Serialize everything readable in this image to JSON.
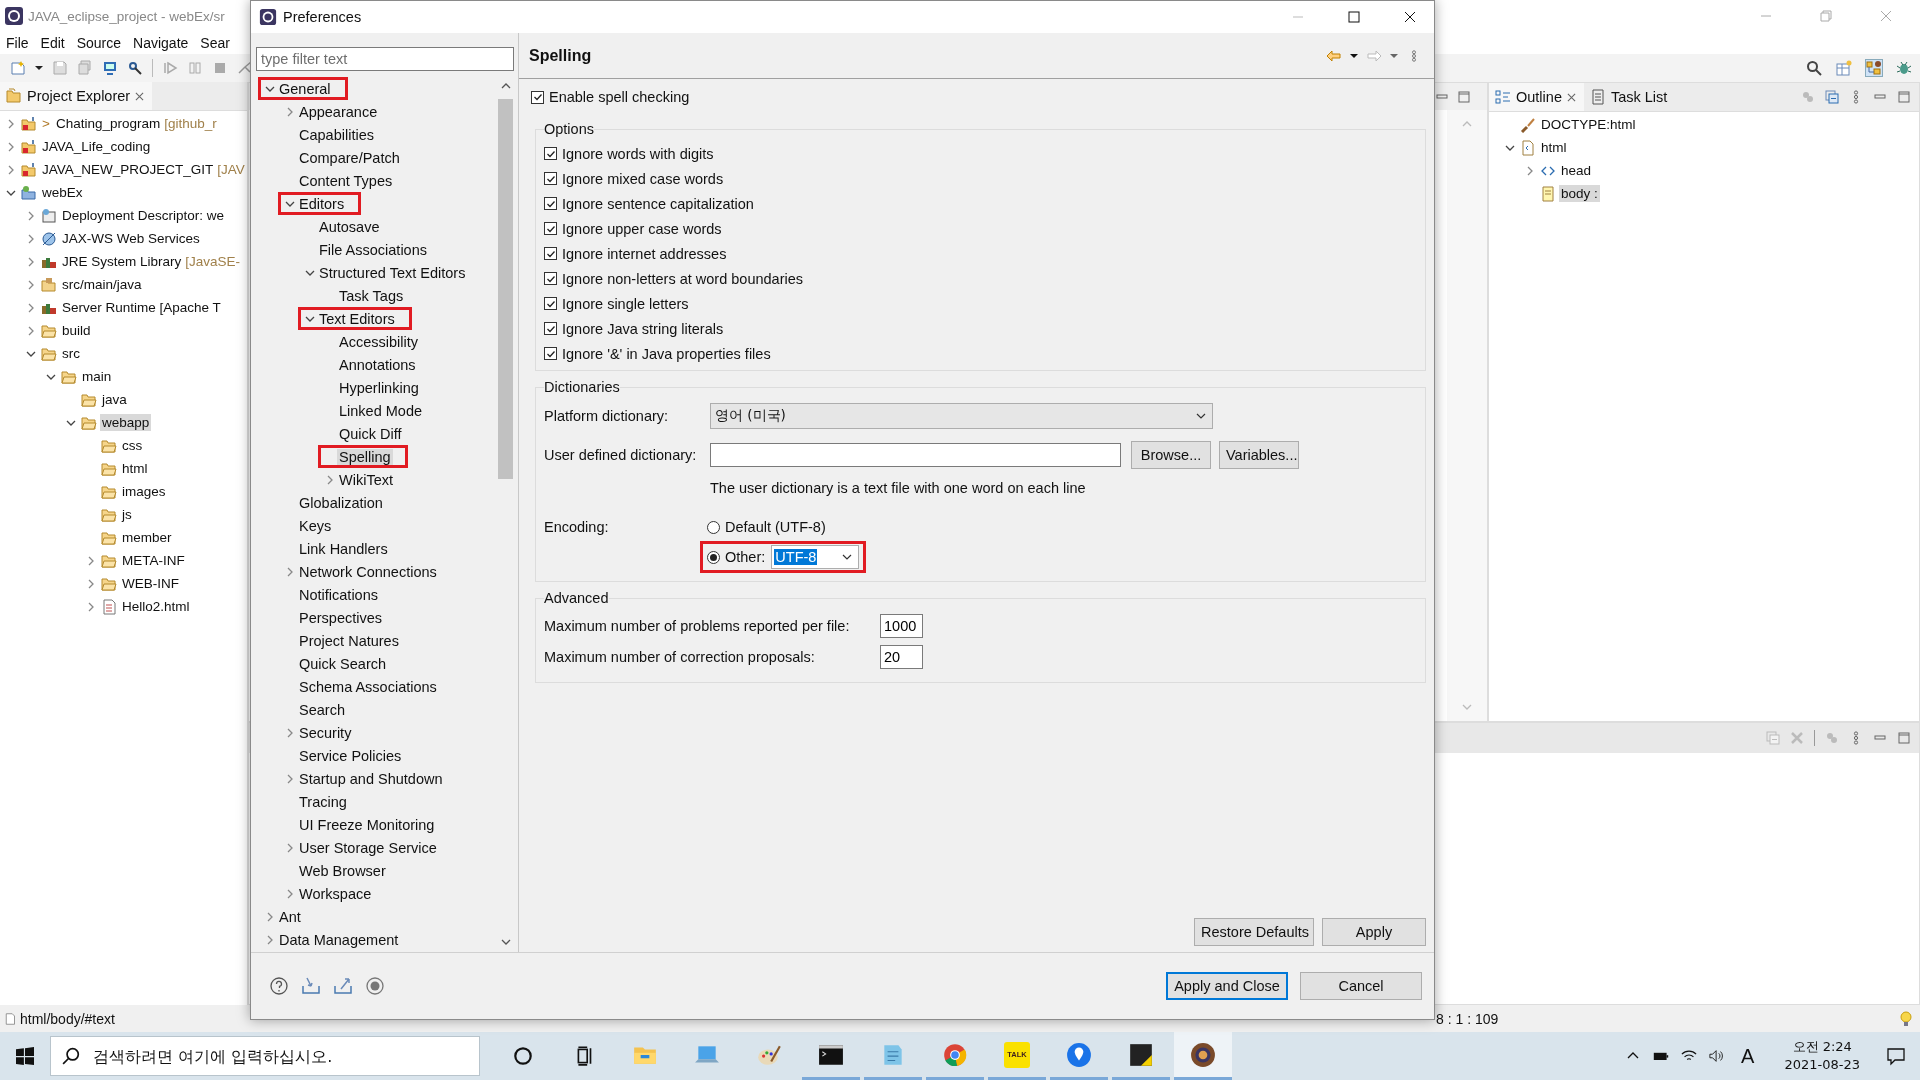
{
  "eclipse": {
    "title": "JAVA_eclipse_project - webEx/sr",
    "menu": [
      "File",
      "Edit",
      "Source",
      "Navigate",
      "Sear"
    ],
    "project_explorer": {
      "tab": "Project Explorer",
      "items": [
        {
          "name": "Chating_program",
          "marker": ">",
          "decoration": "[github_r",
          "kind": "git-project",
          "expanded": false,
          "selected": false
        },
        {
          "name": "JAVA_Life_coding",
          "kind": "git-project",
          "expanded": false,
          "selected": false
        },
        {
          "name": "JAVA_NEW_PROJECT_GIT",
          "decoration": "[JAV",
          "kind": "git-project",
          "expanded": false,
          "selected": false
        },
        {
          "name": "webEx",
          "kind": "web-project",
          "expanded": true,
          "selected": false,
          "children": [
            {
              "name": "Deployment Descriptor: we",
              "kind": "descriptor",
              "expanded": false,
              "selected": false
            },
            {
              "name": "JAX-WS Web Services",
              "kind": "webservice",
              "expanded": false,
              "selected": false
            },
            {
              "name": "JRE System Library",
              "decoration": "[JavaSE-",
              "kind": "library",
              "expanded": false,
              "selected": false
            },
            {
              "name": "src/main/java",
              "kind": "source",
              "expanded": false,
              "selected": false
            },
            {
              "name": "Server Runtime [Apache T",
              "kind": "library",
              "expanded": false,
              "selected": false
            },
            {
              "name": "build",
              "kind": "folder",
              "expanded": false,
              "selected": false
            },
            {
              "name": "src",
              "kind": "folder",
              "expanded": true,
              "selected": false,
              "children": [
                {
                  "name": "main",
                  "kind": "folder",
                  "expanded": true,
                  "selected": false,
                  "children": [
                    {
                      "name": "java",
                      "kind": "folder",
                      "selected": false
                    },
                    {
                      "name": "webapp",
                      "kind": "folder",
                      "expanded": true,
                      "selected": true,
                      "children": [
                        {
                          "name": "css",
                          "kind": "folder",
                          "selected": false
                        },
                        {
                          "name": "html",
                          "kind": "folder",
                          "selected": false
                        },
                        {
                          "name": "images",
                          "kind": "folder",
                          "selected": false
                        },
                        {
                          "name": "js",
                          "kind": "folder",
                          "selected": false
                        },
                        {
                          "name": "member",
                          "kind": "folder",
                          "selected": false
                        },
                        {
                          "name": "META-INF",
                          "kind": "folder",
                          "expanded": false,
                          "selected": false
                        },
                        {
                          "name": "WEB-INF",
                          "kind": "folder",
                          "expanded": false,
                          "selected": false
                        },
                        {
                          "name": "Hello2.html",
                          "kind": "file",
                          "expanded": false,
                          "selected": false
                        }
                      ]
                    }
                  ]
                }
              ]
            }
          ]
        }
      ]
    },
    "outline": {
      "tabs": [
        {
          "label": "Outline",
          "selected": true
        },
        {
          "label": "Task List",
          "selected": false
        }
      ],
      "items": [
        {
          "name": "DOCTYPE:html",
          "kind": "doctype",
          "selected": false
        },
        {
          "name": "html",
          "kind": "element",
          "expanded": true,
          "selected": false,
          "children": [
            {
              "name": "head",
              "kind": "tag",
              "expanded": false,
              "selected": false
            },
            {
              "name": "body :",
              "kind": "text-node",
              "selected": true
            }
          ]
        }
      ]
    },
    "status_bar": {
      "path": "html/body/#text",
      "position": "8 : 1 : 109"
    }
  },
  "preferences": {
    "title": "Preferences",
    "filter_placeholder": "type filter text",
    "tree": [
      {
        "label": "General",
        "expanded": true,
        "selected": false,
        "annotated": true,
        "children": [
          {
            "label": "Appearance",
            "expanded": false,
            "selected": false,
            "annotated": false
          },
          {
            "label": "Capabilities",
            "selected": false,
            "annotated": false
          },
          {
            "label": "Compare/Patch",
            "selected": false,
            "annotated": false
          },
          {
            "label": "Content Types",
            "selected": false,
            "annotated": false
          },
          {
            "label": "Editors",
            "expanded": true,
            "selected": false,
            "annotated": true,
            "children": [
              {
                "label": "Autosave",
                "selected": false,
                "annotated": false
              },
              {
                "label": "File Associations",
                "selected": false,
                "annotated": false
              },
              {
                "label": "Structured Text Editors",
                "expanded": true,
                "selected": false,
                "annotated": false,
                "children": [
                  {
                    "label": "Task Tags",
                    "selected": false,
                    "annotated": false
                  }
                ]
              },
              {
                "label": "Text Editors",
                "expanded": true,
                "selected": false,
                "annotated": true,
                "children": [
                  {
                    "label": "Accessibility",
                    "selected": false,
                    "annotated": false
                  },
                  {
                    "label": "Annotations",
                    "selected": false,
                    "annotated": false
                  },
                  {
                    "label": "Hyperlinking",
                    "selected": false,
                    "annotated": false
                  },
                  {
                    "label": "Linked Mode",
                    "selected": false,
                    "annotated": false
                  },
                  {
                    "label": "Quick Diff",
                    "selected": false,
                    "annotated": false
                  },
                  {
                    "label": "Spelling",
                    "selected": true,
                    "annotated": true
                  },
                  {
                    "label": "WikiText",
                    "expanded": false,
                    "selected": false,
                    "annotated": false
                  }
                ]
              }
            ]
          },
          {
            "label": "Globalization",
            "selected": false,
            "annotated": false
          },
          {
            "label": "Keys",
            "selected": false,
            "annotated": false
          },
          {
            "label": "Link Handlers",
            "selected": false,
            "annotated": false
          },
          {
            "label": "Network Connections",
            "expanded": false,
            "selected": false,
            "annotated": false
          },
          {
            "label": "Notifications",
            "selected": false,
            "annotated": false
          },
          {
            "label": "Perspectives",
            "selected": false,
            "annotated": false
          },
          {
            "label": "Project Natures",
            "selected": false,
            "annotated": false
          },
          {
            "label": "Quick Search",
            "selected": false,
            "annotated": false
          },
          {
            "label": "Schema Associations",
            "selected": false,
            "annotated": false
          },
          {
            "label": "Search",
            "selected": false,
            "annotated": false
          },
          {
            "label": "Security",
            "expanded": false,
            "selected": false,
            "annotated": false
          },
          {
            "label": "Service Policies",
            "selected": false,
            "annotated": false
          },
          {
            "label": "Startup and Shutdown",
            "expanded": false,
            "selected": false,
            "annotated": false
          },
          {
            "label": "Tracing",
            "selected": false,
            "annotated": false
          },
          {
            "label": "UI Freeze Monitoring",
            "selected": false,
            "annotated": false
          },
          {
            "label": "User Storage Service",
            "expanded": false,
            "selected": false,
            "annotated": false
          },
          {
            "label": "Web Browser",
            "selected": false,
            "annotated": false
          },
          {
            "label": "Workspace",
            "expanded": false,
            "selected": false,
            "annotated": false
          }
        ]
      },
      {
        "label": "Ant",
        "expanded": false,
        "selected": false,
        "annotated": false
      },
      {
        "label": "Data Management",
        "expanded": false,
        "selected": false,
        "annotated": false
      }
    ],
    "page": {
      "title": "Spelling",
      "enable": {
        "label": "Enable spell checking",
        "checked": true
      },
      "options": {
        "title": "Options",
        "items": [
          {
            "label": "Ignore words with digits",
            "checked": true
          },
          {
            "label": "Ignore mixed case words",
            "checked": true
          },
          {
            "label": "Ignore sentence capitalization",
            "checked": true
          },
          {
            "label": "Ignore upper case words",
            "checked": true
          },
          {
            "label": "Ignore internet addresses",
            "checked": true
          },
          {
            "label": "Ignore non-letters at word boundaries",
            "checked": true
          },
          {
            "label": "Ignore single letters",
            "checked": true
          },
          {
            "label": "Ignore Java string literals",
            "checked": true
          },
          {
            "label": "Ignore '&' in Java properties files",
            "checked": true
          }
        ]
      },
      "dictionaries": {
        "title": "Dictionaries",
        "platform_label": "Platform dictionary:",
        "platform_value": "영어 (미국)",
        "user_label": "User defined dictionary:",
        "browse": "Browse...",
        "variables": "Variables...",
        "note": "The user dictionary is a text file with one word on each line",
        "encoding_label": "Encoding:",
        "encodings": [
          {
            "label": "Default (UTF-8)",
            "selected": false,
            "annotated": false
          },
          {
            "label": "Other:",
            "selected": true,
            "annotated": true,
            "value": "UTF-8"
          }
        ]
      },
      "advanced": {
        "title": "Advanced",
        "rows": [
          {
            "label": "Maximum number of problems reported per file:",
            "value": "1000"
          },
          {
            "label": "Maximum number of correction proposals:",
            "value": "20"
          }
        ]
      },
      "restore": "Restore Defaults",
      "apply": "Apply"
    },
    "footer": {
      "apply_close": "Apply and Close",
      "cancel": "Cancel"
    }
  },
  "taskbar": {
    "search_placeholder": "검색하려면 여기에 입력하십시오.",
    "apps": [
      {
        "kind": "explorer",
        "running": false,
        "selected": false
      },
      {
        "kind": "computer",
        "running": false,
        "selected": false
      },
      {
        "kind": "paint",
        "running": false,
        "selected": false
      },
      {
        "kind": "terminal",
        "running": true,
        "selected": false
      },
      {
        "kind": "notepad",
        "running": true,
        "selected": false
      },
      {
        "kind": "browser",
        "running": true,
        "selected": false
      },
      {
        "kind": "chat",
        "running": true,
        "selected": false,
        "label": "TALK"
      },
      {
        "kind": "maps",
        "running": true,
        "selected": false
      },
      {
        "kind": "sticky",
        "running": true,
        "selected": false
      },
      {
        "kind": "eclipse",
        "running": true,
        "selected": true
      }
    ],
    "ime": "A",
    "time": "오전 2:24",
    "date": "2021-08-23"
  }
}
